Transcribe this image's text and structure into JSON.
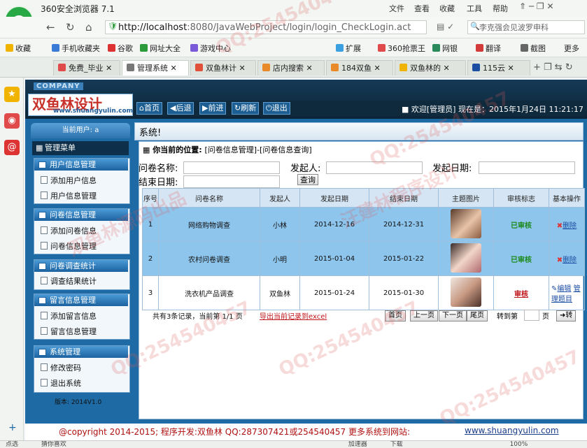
{
  "browser": {
    "title": "360安全浏览器 7.1",
    "menu": [
      "文件",
      "查看",
      "收藏",
      "工具",
      "帮助"
    ],
    "url_host": "http://localhost",
    "url_rest": ":8080/JavaWebProject/login/login_CheckLogin.act",
    "search_text": "李克强会见波罗申科",
    "bookmarks": [
      "收藏",
      "手机收藏夹",
      "谷歌",
      "网址大全",
      "游戏中心",
      "扩展",
      "360抢票王",
      "网银",
      "翻译",
      "截图",
      "更多"
    ],
    "tabs": [
      "免费_毕业",
      "管理系统",
      "双鱼林计",
      "店内搜索",
      "184双鱼",
      "双鱼林的",
      "115云"
    ],
    "status_items": [
      "点选",
      "猜你喜欢",
      "加速器",
      "下载",
      "100%"
    ]
  },
  "app": {
    "company": "COMPANY",
    "brand_name": "双鱼林设计",
    "brand_url": "www.shuangyulin.com",
    "nav": [
      "首页",
      "后退",
      "前进",
      "刷新",
      "退出"
    ],
    "welcome": "欢迎[管理员]  现在是：2015年1月24日 11:21:17",
    "system_label": "系统!",
    "current_user": "当前用户: a",
    "menu_title": "管理菜单",
    "groups": [
      {
        "title": "用户信息管理",
        "items": [
          "添加用户信息",
          "用户信息管理"
        ]
      },
      {
        "title": "问卷信息管理",
        "items": [
          "添加问卷信息",
          "问卷信息管理"
        ]
      },
      {
        "title": "问卷调查统计",
        "items": [
          "调查结果统计"
        ]
      },
      {
        "title": "留言信息管理",
        "items": [
          "添加留言信息",
          "留言信息管理"
        ]
      },
      {
        "title": "系统管理",
        "items": [
          "修改密码",
          "退出系统"
        ]
      }
    ],
    "version": "版本: 2014V1.0"
  },
  "content": {
    "location_label": "你当前的位置:",
    "location_path": "[问卷信息管理]-[问卷信息查询]",
    "filters": {
      "name_label": "问卷名称:",
      "initiator_label": "发起人:",
      "start_label": "发起日期:",
      "end_label": "结束日期:",
      "query_button": "查询"
    },
    "columns": [
      "序号",
      "问卷名称",
      "发起人",
      "发起日期",
      "结束日期",
      "主题图片",
      "审核标志",
      "基本操作"
    ],
    "rows": [
      {
        "no": "1",
        "name": "网络购物调查",
        "initiator": "小林",
        "start": "2014-12-16",
        "end": "2014-12-31",
        "status": "已审核",
        "op": "删除"
      },
      {
        "no": "2",
        "name": "农村问卷调查",
        "initiator": "小明",
        "start": "2015-01-04",
        "end": "2015-01-22",
        "status": "已审核",
        "op": "删除"
      },
      {
        "no": "3",
        "name": "洗衣机产品调查",
        "initiator": "双鱼林",
        "start": "2015-01-24",
        "end": "2015-01-30",
        "status": "审核",
        "op": "编辑",
        "op2": "管理题目"
      }
    ],
    "pager": {
      "info": "共有3条记录，当前第 1/1 页",
      "export": "导出当前记录到excel",
      "buttons": [
        "首页",
        "上一页",
        "下一页",
        "尾页"
      ],
      "goto_label": "转到第",
      "page_suffix": "页",
      "go": "转"
    }
  },
  "footer": {
    "text": "@copyright 2014-2015; 程序开发:双鱼林  QQ:287307421或254540457  更多系统到网站:",
    "link": "www.shuangyulin.com"
  },
  "watermarks": [
    "QQ:254540457",
    "汪建林程序设计",
    "双鱼林源码出品"
  ]
}
